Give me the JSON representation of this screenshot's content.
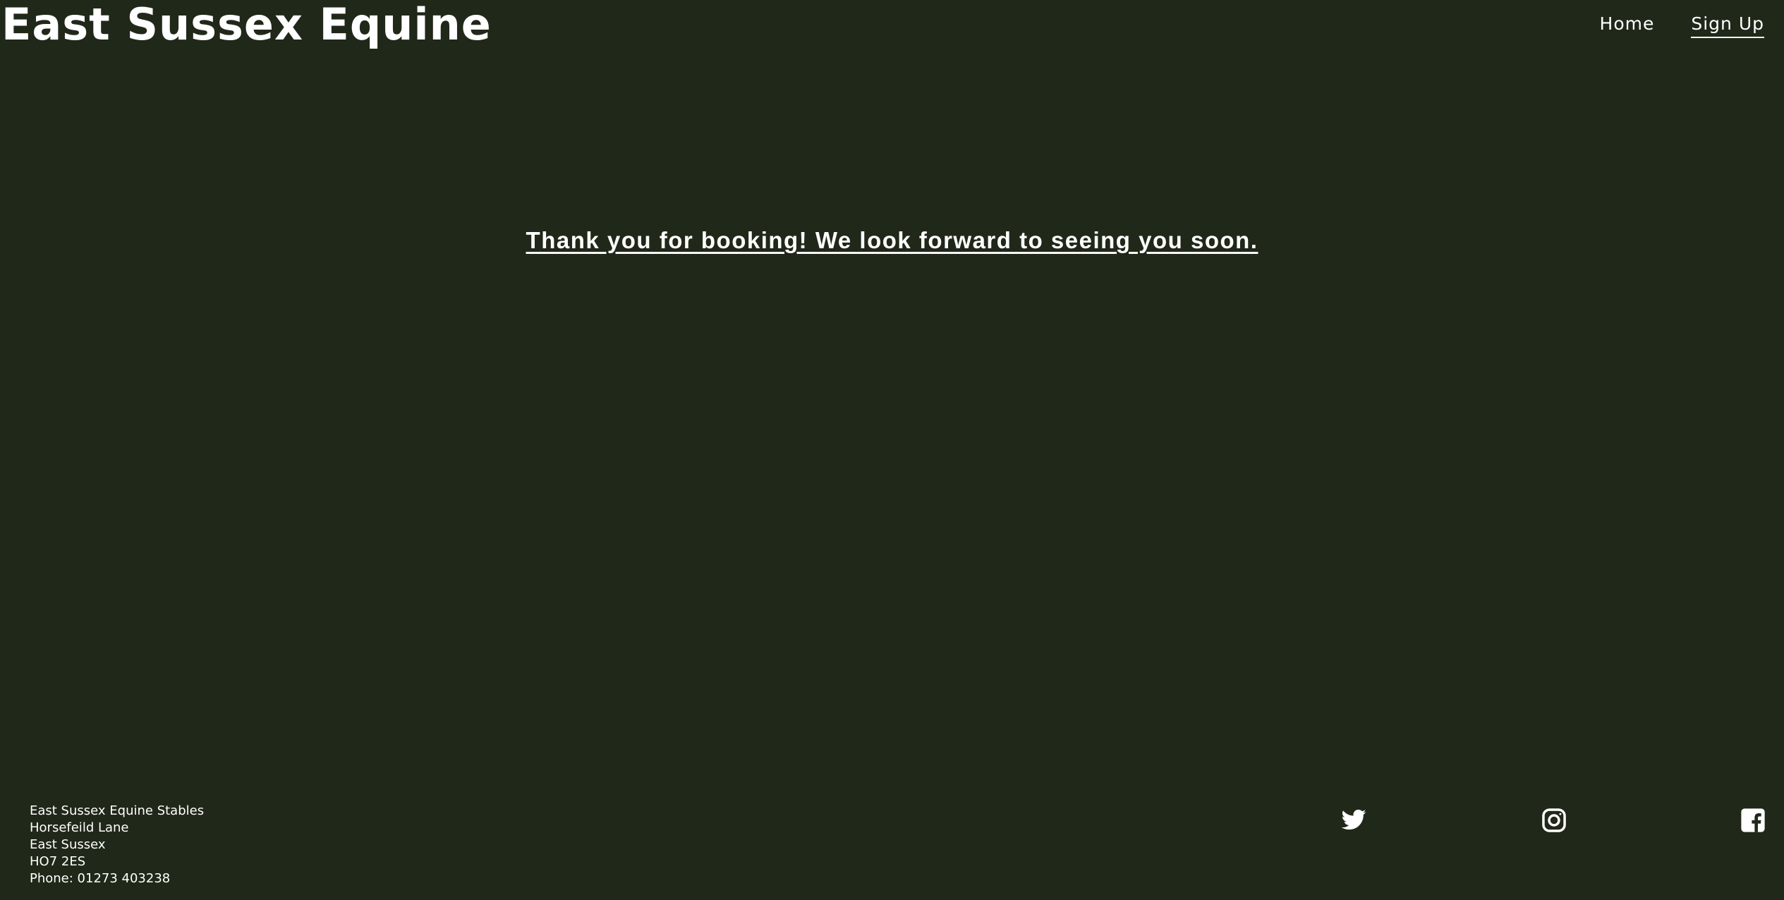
{
  "header": {
    "site_title": "East Sussex Equine",
    "nav": [
      {
        "label": "Home"
      },
      {
        "label": "Sign Up"
      }
    ]
  },
  "main": {
    "message": "Thank you for booking! We look forward to seeing you soon."
  },
  "footer": {
    "address_lines": [
      "East Sussex Equine Stables",
      "Horsefeild Lane",
      "East Sussex",
      "HO7 2ES",
      "Phone: 01273 403238"
    ],
    "social_icons": [
      "twitter-icon",
      "instagram-icon",
      "facebook-icon"
    ]
  },
  "colors": {
    "background": "#202819",
    "text": "#ffffff"
  }
}
